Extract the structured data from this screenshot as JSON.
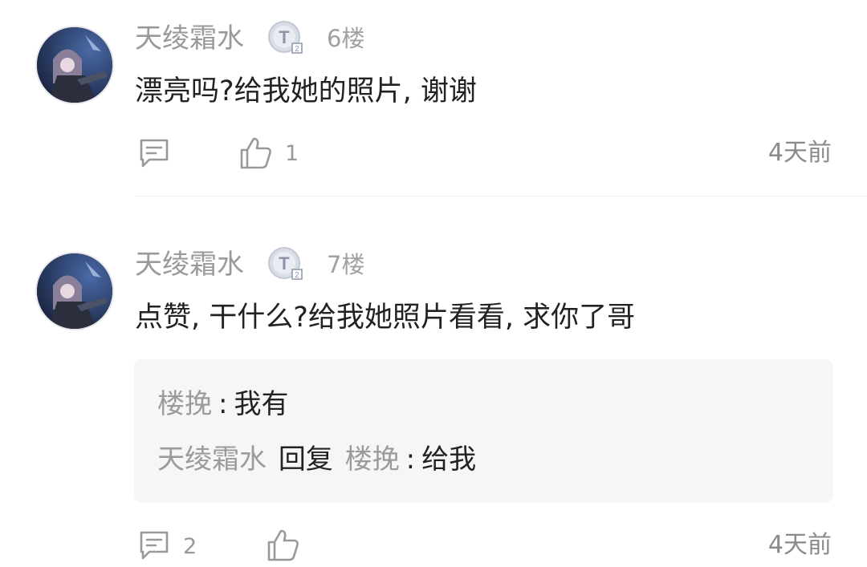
{
  "comments": [
    {
      "author": "天绫霜水",
      "badge": "T2",
      "floor": "6楼",
      "text": "漂亮吗?给我她的照片, 谢谢",
      "like_count": "1",
      "reply_count": "",
      "time": "4天前"
    },
    {
      "author": "天绫霜水",
      "badge": "T2",
      "floor": "7楼",
      "text": "点赞, 干什么?给我她照片看看, 求你了哥",
      "like_count": "",
      "reply_count": "2",
      "time": "4天前",
      "replies": [
        {
          "user": "楼挽",
          "sep": ":",
          "text": "我有"
        },
        {
          "user": "天绫霜水",
          "reply_word": "回复",
          "target": "楼挽",
          "sep": ":",
          "text": "给我"
        }
      ]
    }
  ],
  "icons": {
    "comment": "comment-bubble-icon",
    "like": "thumbs-up-icon",
    "badge": "level-badge-icon"
  },
  "colors": {
    "author": "#9a9a9a",
    "text": "#222222",
    "reply_bg": "#f6f6f6"
  }
}
